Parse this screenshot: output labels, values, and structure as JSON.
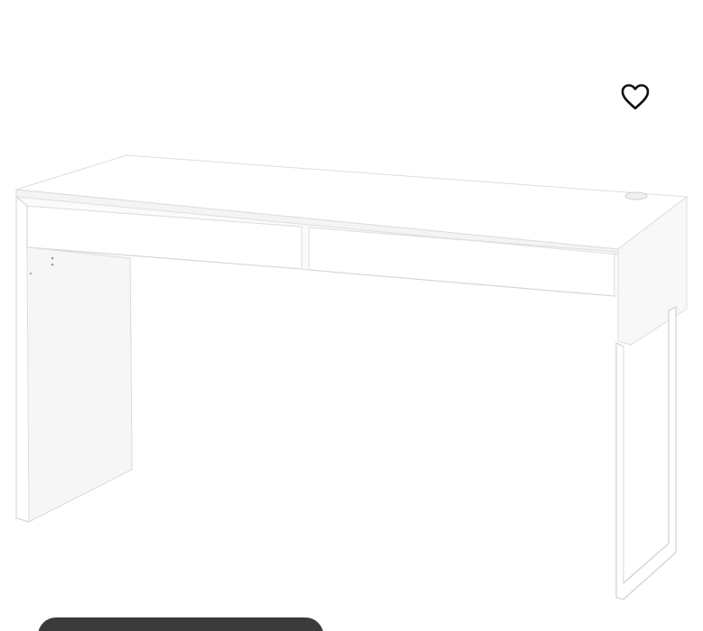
{
  "product": {
    "image_alt": "",
    "icon": "desk-image"
  },
  "favorite": {
    "icon": "heart-outline-icon",
    "color": "#111111"
  },
  "colors": {
    "background": "#ffffff",
    "desk_white": "#ffffff",
    "desk_shadow": "#e9e9e9",
    "desk_line": "#d9d9d9",
    "bottom_pill": "#3b3b3b"
  }
}
